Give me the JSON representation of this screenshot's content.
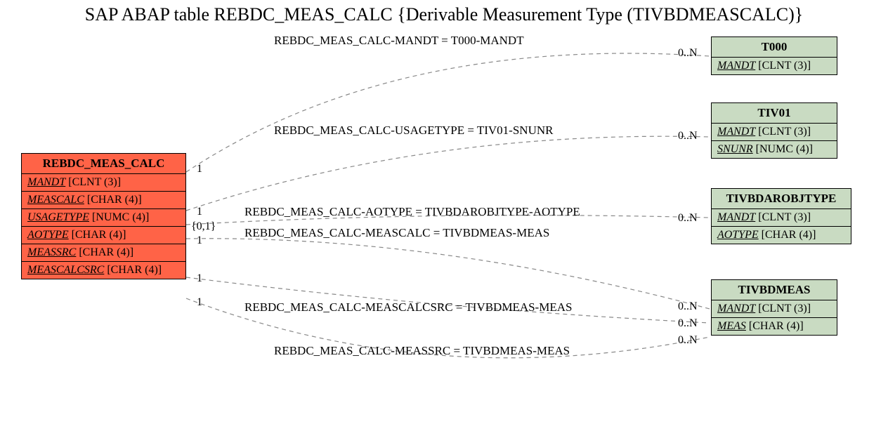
{
  "title": "SAP ABAP table REBDC_MEAS_CALC {Derivable Measurement Type (TIVBDMEASCALC)}",
  "main": {
    "name": "REBDC_MEAS_CALC",
    "fields": [
      {
        "name": "MANDT",
        "type": "[CLNT (3)]",
        "key": true
      },
      {
        "name": "MEASCALC",
        "type": "[CHAR (4)]",
        "key": true
      },
      {
        "name": "USAGETYPE",
        "type": "[NUMC (4)]",
        "key": true
      },
      {
        "name": "AOTYPE",
        "type": "[CHAR (4)]",
        "key": true
      },
      {
        "name": "MEASSRC",
        "type": "[CHAR (4)]",
        "key": true
      },
      {
        "name": "MEASCALCSRC",
        "type": "[CHAR (4)]",
        "key": true
      }
    ]
  },
  "refs": {
    "t000": {
      "name": "T000",
      "fields": [
        {
          "name": "MANDT",
          "type": "[CLNT (3)]",
          "key": true
        }
      ]
    },
    "tiv01": {
      "name": "TIV01",
      "fields": [
        {
          "name": "MANDT",
          "type": "[CLNT (3)]",
          "key": true
        },
        {
          "name": "SNUNR",
          "type": "[NUMC (4)]",
          "key": true
        }
      ]
    },
    "tivbdarobjtype": {
      "name": "TIVBDAROBJTYPE",
      "fields": [
        {
          "name": "MANDT",
          "type": "[CLNT (3)]",
          "key": true
        },
        {
          "name": "AOTYPE",
          "type": "[CHAR (4)]",
          "key": true
        }
      ]
    },
    "tivbdmeas": {
      "name": "TIVBDMEAS",
      "fields": [
        {
          "name": "MANDT",
          "type": "[CLNT (3)]",
          "key": true
        },
        {
          "name": "MEAS",
          "type": "[CHAR (4)]",
          "key": true
        }
      ]
    }
  },
  "relations": {
    "r1": "REBDC_MEAS_CALC-MANDT = T000-MANDT",
    "r2": "REBDC_MEAS_CALC-USAGETYPE = TIV01-SNUNR",
    "r3": "REBDC_MEAS_CALC-AOTYPE = TIVBDAROBJTYPE-AOTYPE",
    "r4": "REBDC_MEAS_CALC-MEASCALC = TIVBDMEAS-MEAS",
    "r5": "REBDC_MEAS_CALC-MEASCALCSRC = TIVBDMEAS-MEAS",
    "r6": "REBDC_MEAS_CALC-MEASSRC = TIVBDMEAS-MEAS"
  },
  "cards": {
    "c1l": "1",
    "c1r": "0..N",
    "c2l": "1",
    "c2r": "0..N",
    "c3l": "{0,1}",
    "c3r": "0..N",
    "c4l": "1",
    "c5l": "1",
    "c5r": "0..N",
    "c6l": "1",
    "c6r": "0..N",
    "c4r": "0..N"
  }
}
